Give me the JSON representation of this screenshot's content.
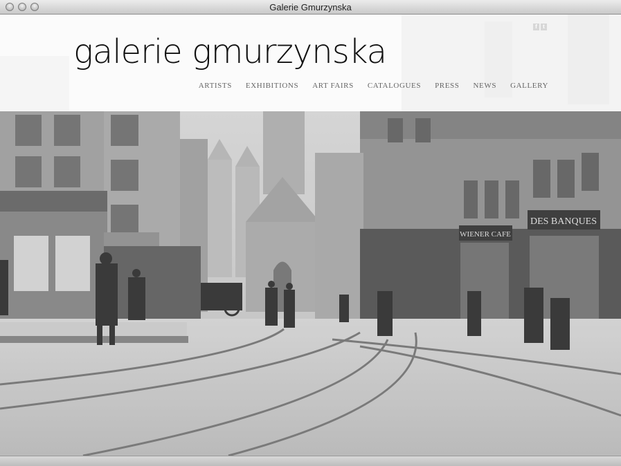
{
  "window": {
    "title": "Galerie Gmurzynska"
  },
  "site": {
    "logo": "galerie gmurzynska",
    "social": [
      "f",
      "t"
    ],
    "nav": [
      "ARTISTS",
      "EXHIBITIONS",
      "ART FAIRS",
      "CATALOGUES",
      "PRESS",
      "NEWS",
      "GALLERY"
    ]
  },
  "hero": {
    "signs": [
      "DES BANQUES",
      "WIENER CAFE"
    ]
  }
}
